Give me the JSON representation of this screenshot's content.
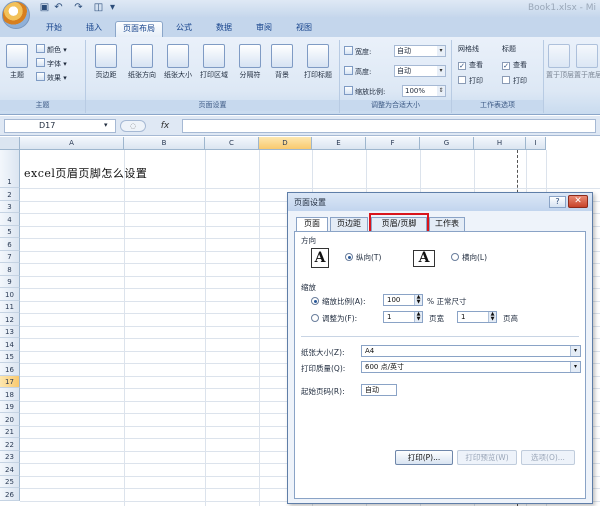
{
  "title_bar": {
    "title": "Book1.xlsx - Mi"
  },
  "tabs": [
    "开始",
    "插入",
    "页面布局",
    "公式",
    "数据",
    "审阅",
    "视图"
  ],
  "active_tab": "页面布局",
  "ribbon": {
    "theme_group": {
      "label": "主题",
      "themes": "主题",
      "colors": "颜色",
      "fonts": "字体",
      "effects": "效果"
    },
    "page_setup_group": {
      "label": "页面设置",
      "buttons": [
        "页边距",
        "纸张方向",
        "纸张大小",
        "打印区域",
        "分隔符",
        "背景",
        "打印标题"
      ]
    },
    "scale_group": {
      "label": "调整为合适大小",
      "width_label": "宽度:",
      "width_value": "自动",
      "height_label": "高度:",
      "height_value": "自动",
      "scale_label": "缩放比例:",
      "scale_value": "100%"
    },
    "sheet_options_group": {
      "label": "工作表选项",
      "gridlines": "网格线",
      "headings": "标题",
      "view": "查看",
      "print": "打印"
    },
    "arrange_group": {
      "bring_forward": "置于顶层",
      "send_backward": "置于底层"
    }
  },
  "formula_bar": {
    "name_box": "D17",
    "fx": "fx",
    "formula": ""
  },
  "sheet": {
    "columns": [
      "A",
      "B",
      "C",
      "D",
      "E",
      "F",
      "G",
      "H",
      "I"
    ],
    "selected_column": "D",
    "rows": [
      "1",
      "2",
      "3",
      "4",
      "5",
      "6",
      "7",
      "8",
      "9",
      "10",
      "11",
      "12",
      "13",
      "14",
      "15",
      "16",
      "17",
      "18",
      "19",
      "20",
      "21",
      "22",
      "23",
      "24",
      "25",
      "26"
    ],
    "selected_row": "17",
    "cell_a1": "excel页眉页脚怎么设置"
  },
  "dialog": {
    "title": "页面设置",
    "help": "?",
    "close": "✕",
    "tabs": [
      "页面",
      "页边距",
      "页眉/页脚",
      "工作表"
    ],
    "active_tab": "页面",
    "highlighted_tab": "页眉/页脚",
    "orientation": {
      "label": "方向",
      "portrait": "纵向(T)",
      "landscape": "横向(L)",
      "selected": "纵向(T)",
      "icon_text": "A"
    },
    "scaling": {
      "label": "缩放",
      "adjust_to": "缩放比例(A):",
      "adjust_value": "100",
      "adjust_suffix": "% 正常尺寸",
      "fit_to": "调整为(F):",
      "fit_wide_value": "1",
      "fit_wide_label": "页宽",
      "fit_tall_value": "1",
      "fit_tall_label": "页高",
      "selected": "adjust"
    },
    "paper_size": {
      "label": "纸张大小(Z):",
      "value": "A4"
    },
    "print_quality": {
      "label": "打印质量(Q):",
      "value": "600 点/英寸"
    },
    "first_page": {
      "label": "起始页码(R):",
      "value": "自动"
    },
    "buttons": {
      "print": "打印(P)...",
      "preview": "打印预览(W)",
      "options": "选项(O)..."
    }
  }
}
